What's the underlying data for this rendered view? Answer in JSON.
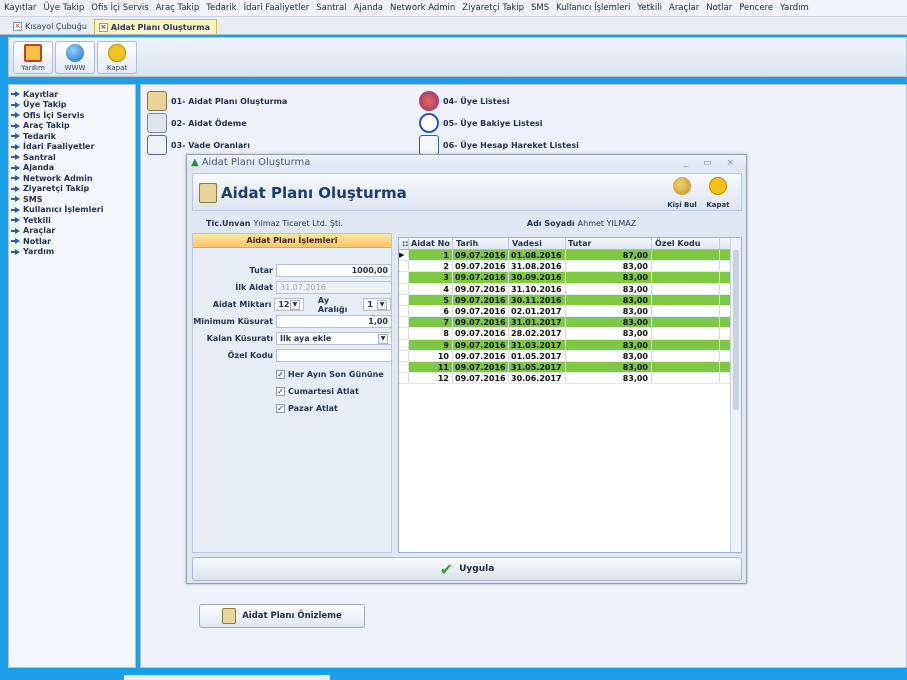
{
  "menu": [
    "Kayıtlar",
    "Üye Takip",
    "Ofis İçi Servis",
    "Araç Takip",
    "Tedarik",
    "İdari Faaliyetler",
    "Santral",
    "Ajanda",
    "Network Admin",
    "Ziyaretçi Takip",
    "SMS",
    "Kullanıcı İşlemleri",
    "Yetkili",
    "Araçlar",
    "Notlar",
    "Pencere",
    "Yardım"
  ],
  "tabs": [
    {
      "label": "Kısayol Çubuğu"
    },
    {
      "label": "Aidat Planı Oluşturma"
    }
  ],
  "toolbar": {
    "help": "Yardım",
    "www": "WWW",
    "close": "Kapat"
  },
  "sidebar": [
    "Kayıtlar",
    "Üye Takip",
    "Ofis İçi Servis",
    "Araç Takip",
    "Tedarik",
    "İdari Faaliyetler",
    "Santral",
    "Ajanda",
    "Network Admin",
    "Ziyaretçi Takip",
    "SMS",
    "Kullanıcı İşlemleri",
    "Yetkili",
    "Araçlar",
    "Notlar",
    "Yardım"
  ],
  "shortcuts": {
    "s1": "01- Aidat Planı Oluşturma",
    "s2": "02- Aidat Ödeme",
    "s3": "03- Vade Oranları",
    "s4": "04- Üye Listesi",
    "s5": "05- Üye Bakiye Listesi",
    "s6": "06- Üye Hesap Hareket Listesi"
  },
  "dialog": {
    "window_title": "Aidat Planı Oluşturma",
    "header_title": "Aidat Planı Oluşturma",
    "find_person": "Kişi Bul",
    "close": "Kapat",
    "company_label": "Tic.Unvan",
    "company_value": "Yılmaz Ticaret Ltd. Şti.",
    "name_label": "Adı Soyadı",
    "name_value": "Ahmet YILMAZ",
    "panel_title": "Aidat Planı İşlemleri",
    "amount_label": "Tutar",
    "amount_value": "1000,00",
    "first_label": "İlk Aidat",
    "first_value": "31.07.2016",
    "count_label": "Aidat Miktarı",
    "count_value": "12",
    "interval_label": "Ay Aralığı",
    "interval_value": "1",
    "min_label": "Minimum Küsurat",
    "min_value": "1,00",
    "rem_label": "Kalan Küsuratı",
    "rem_value": "Ilk aya ekle",
    "code_label": "Özel Kodu",
    "code_value": "",
    "chk1": "Her Ayın Son Gününe",
    "chk2": "Cumartesi Atlat",
    "chk3": "Pazar Atlat",
    "preview": "Aidat Planı Önizleme",
    "apply": "Uygula",
    "columns": [
      "Aidat No",
      "Tarih",
      "Vadesi",
      "Tutar",
      "Özel Kodu"
    ],
    "rows": [
      {
        "no": "1",
        "tarih": "09.07.2016",
        "vade": "01.08.2016",
        "tutar": "87,00",
        "kod": ""
      },
      {
        "no": "2",
        "tarih": "09.07.2016",
        "vade": "31.08.2016",
        "tutar": "83,00",
        "kod": ""
      },
      {
        "no": "3",
        "tarih": "09.07.2016",
        "vade": "30.09.2016",
        "tutar": "83,00",
        "kod": ""
      },
      {
        "no": "4",
        "tarih": "09.07.2016",
        "vade": "31.10.2016",
        "tutar": "83,00",
        "kod": ""
      },
      {
        "no": "5",
        "tarih": "09.07.2016",
        "vade": "30.11.2016",
        "tutar": "83,00",
        "kod": ""
      },
      {
        "no": "6",
        "tarih": "09.07.2016",
        "vade": "02.01.2017",
        "tutar": "83,00",
        "kod": ""
      },
      {
        "no": "7",
        "tarih": "09.07.2016",
        "vade": "31.01.2017",
        "tutar": "83,00",
        "kod": ""
      },
      {
        "no": "8",
        "tarih": "09.07.2016",
        "vade": "28.02.2017",
        "tutar": "83,00",
        "kod": ""
      },
      {
        "no": "9",
        "tarih": "09.07.2016",
        "vade": "31.03.2017",
        "tutar": "83,00",
        "kod": ""
      },
      {
        "no": "10",
        "tarih": "09.07.2016",
        "vade": "01.05.2017",
        "tutar": "83,00",
        "kod": ""
      },
      {
        "no": "11",
        "tarih": "09.07.2016",
        "vade": "31.05.2017",
        "tutar": "83,00",
        "kod": ""
      },
      {
        "no": "12",
        "tarih": "09.07.2016",
        "vade": "30.06.2017",
        "tutar": "83,00",
        "kod": ""
      }
    ]
  },
  "colors": {
    "accent": "#1aa0e6",
    "row_green": "#7fc843",
    "panel_header": "#ffc766"
  }
}
